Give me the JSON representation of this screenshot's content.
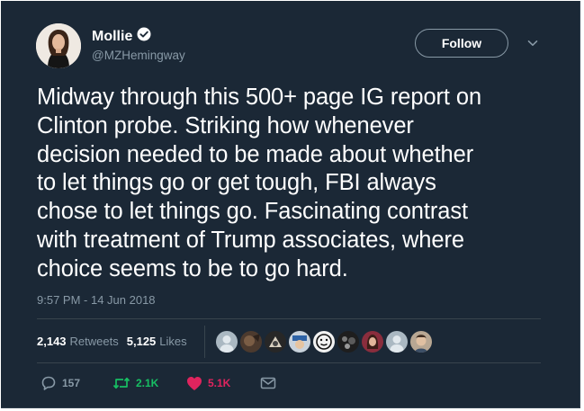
{
  "author": {
    "display_name": "Mollie",
    "handle": "@MZHemingway",
    "verified": true
  },
  "follow_label": "Follow",
  "tweet": {
    "lines": [
      "Midway through this 500+ page IG report on",
      "Clinton probe. Striking how whenever",
      "decision needed to be made about whether",
      "to let things go or get tough, FBI always",
      "chose to let things go. Fascinating contrast",
      "with treatment of Trump associates, where",
      "choice seems to be to go hard."
    ],
    "timestamp": "9:57 PM - 14 Jun 2018"
  },
  "stats": {
    "retweets_count": "2,143",
    "retweets_label": "Retweets",
    "likes_count": "5,125",
    "likes_label": "Likes"
  },
  "actions": {
    "reply_count": "157",
    "retweet_count": "2.1K",
    "like_count": "5.1K"
  },
  "colors": {
    "background": "#1b2836",
    "text_primary": "#ffffff",
    "text_secondary": "#8899a6",
    "divider": "#38444d",
    "retweet_green": "#17bf63",
    "like_red": "#e0245e"
  },
  "icons": {
    "verified": "verified-badge-icon",
    "caret": "chevron-down-icon",
    "reply": "reply-icon",
    "retweet": "retweet-icon",
    "like": "heart-icon",
    "message": "envelope-icon"
  }
}
